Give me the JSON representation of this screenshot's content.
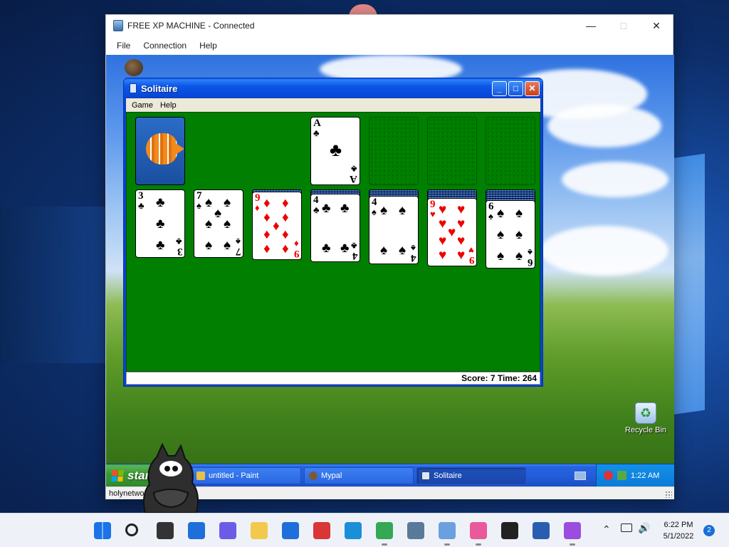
{
  "host": {
    "window_title": "FREE XP MACHINE - Connected",
    "menu": [
      "File",
      "Connection",
      "Help"
    ],
    "status_text": "holynetwo"
  },
  "xp": {
    "recycle_bin_label": "Recycle Bin",
    "start_label": "start",
    "tasks": [
      {
        "label": "untitled - Paint",
        "icon": "paint-icon"
      },
      {
        "label": "Mypal",
        "icon": "mypal-icon"
      },
      {
        "label": "Solitaire",
        "icon": "solitaire-icon",
        "active": true
      }
    ],
    "clock": "1:22 AM"
  },
  "solitaire": {
    "title": "Solitaire",
    "menu": [
      "Game",
      "Help"
    ],
    "status": "Score: 7 Time: 264",
    "foundations": [
      {
        "rank": "A",
        "suit": "♣",
        "color": "black"
      },
      {
        "empty": true
      },
      {
        "empty": true
      },
      {
        "empty": true
      }
    ],
    "tableau": [
      {
        "hidden": 0,
        "rank": "3",
        "suit": "♣",
        "color": "black"
      },
      {
        "hidden": 0,
        "rank": "7",
        "suit": "♠",
        "color": "black"
      },
      {
        "hidden": 1,
        "rank": "9",
        "suit": "♦",
        "color": "red"
      },
      {
        "hidden": 2,
        "rank": "4",
        "suit": "♣",
        "color": "black"
      },
      {
        "hidden": 3,
        "rank": "4",
        "suit": "♠",
        "color": "black"
      },
      {
        "hidden": 4,
        "rank": "9",
        "suit": "♥",
        "color": "red"
      },
      {
        "hidden": 5,
        "rank": "6",
        "suit": "♠",
        "color": "black"
      }
    ]
  },
  "win11": {
    "clock_time": "6:22 PM",
    "clock_date": "5/1/2022",
    "notification_count": "2",
    "taskbar_icons": [
      "windows-start-icon",
      "search-icon",
      "task-view-icon",
      "widgets-icon",
      "chat-icon",
      "file-explorer-icon",
      "store-icon",
      "news-icon",
      "edge-icon",
      "chrome-icon",
      "control-panel-icon",
      "remote-desktop-icon",
      "paint-3d-icon",
      "terminal-icon",
      "notepad-icon",
      "visual-studio-icon"
    ]
  }
}
